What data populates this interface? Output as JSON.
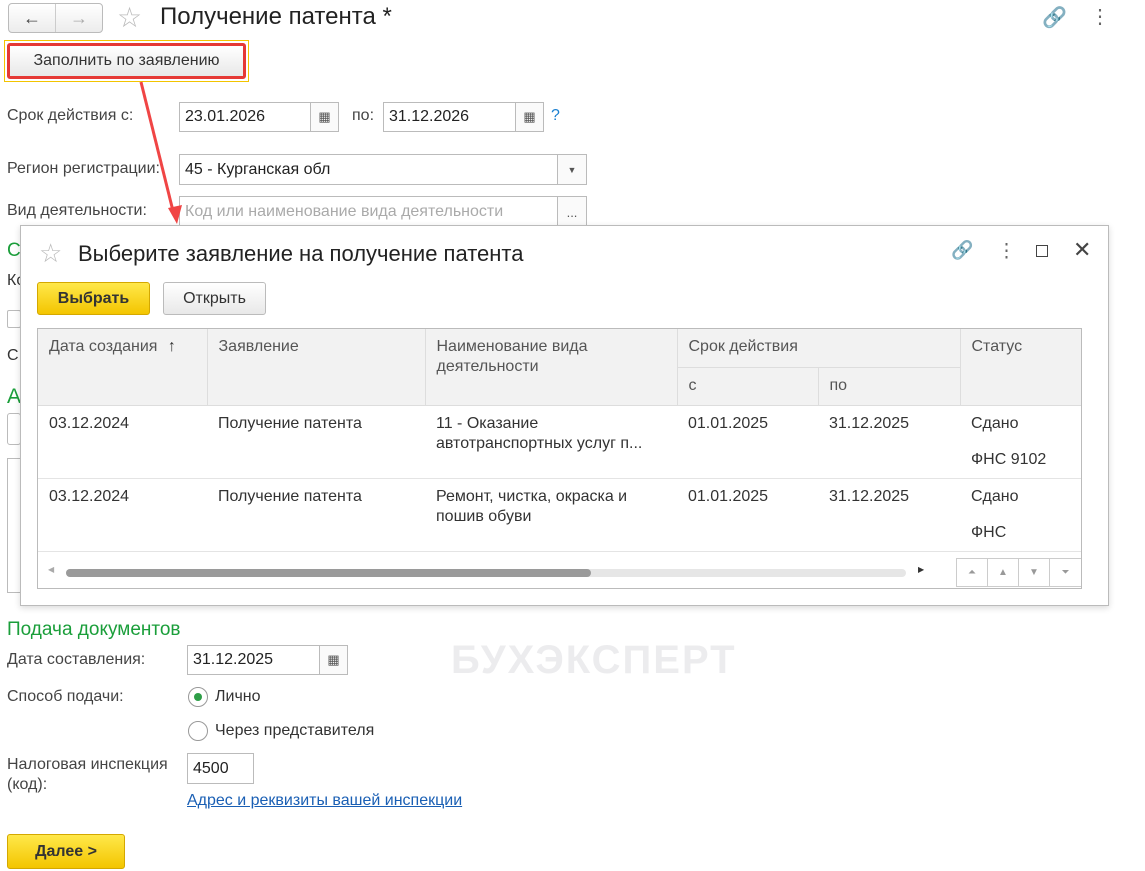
{
  "header": {
    "title": "Получение патента *",
    "back": "←",
    "forward": "→"
  },
  "fill_button": "Заполнить по заявлению",
  "period": {
    "label_from": "Срок действия с:",
    "from": "23.01.2026",
    "label_to": "по:",
    "to": "31.12.2026",
    "help": "?"
  },
  "region": {
    "label": "Регион регистрации:",
    "value": "45 - Курганская обл"
  },
  "activity": {
    "label": "Вид деятельности:",
    "placeholder": "Код или наименование вида деятельности",
    "more": "..."
  },
  "hidden_fragments": [
    "С",
    "Ко",
    "С",
    "А"
  ],
  "dialog": {
    "title": "Выберите заявление на получение патента",
    "select_button": "Выбрать",
    "open_button": "Открыть",
    "watermark": "БУХЭКСПЕРТ",
    "columns": {
      "date": "Дата создания",
      "sort": "↑",
      "statement": "Заявление",
      "activity": "Наименование вида деятельности",
      "period": "Срок действия",
      "from": "с",
      "to": "по",
      "status": "Статус"
    },
    "rows": [
      {
        "date": "03.12.2024",
        "statement": "Получение патента",
        "activity": "11 - Оказание автотранспортных услуг п...",
        "from": "01.01.2025",
        "to": "31.12.2025",
        "status": "Сдано",
        "status2": "ФНС 9102"
      },
      {
        "date": "03.12.2024",
        "statement": "Получение патента",
        "activity": "Ремонт, чистка, окраска и пошив обуви",
        "from": "01.01.2025",
        "to": "31.12.2025",
        "status": "Сдано",
        "status2": "ФНС"
      }
    ]
  },
  "submission": {
    "heading": "Подача документов",
    "date_label": "Дата составления:",
    "date": "31.12.2025",
    "method_label": "Способ подачи:",
    "method_options": [
      "Лично",
      "Через представителя"
    ],
    "method_selected": 0,
    "inspection_label": "Налоговая инспекция (код):",
    "inspection_value": "4500",
    "inspection_link": "Адрес и реквизиты вашей инспекции"
  },
  "next_button": "Далее >"
}
